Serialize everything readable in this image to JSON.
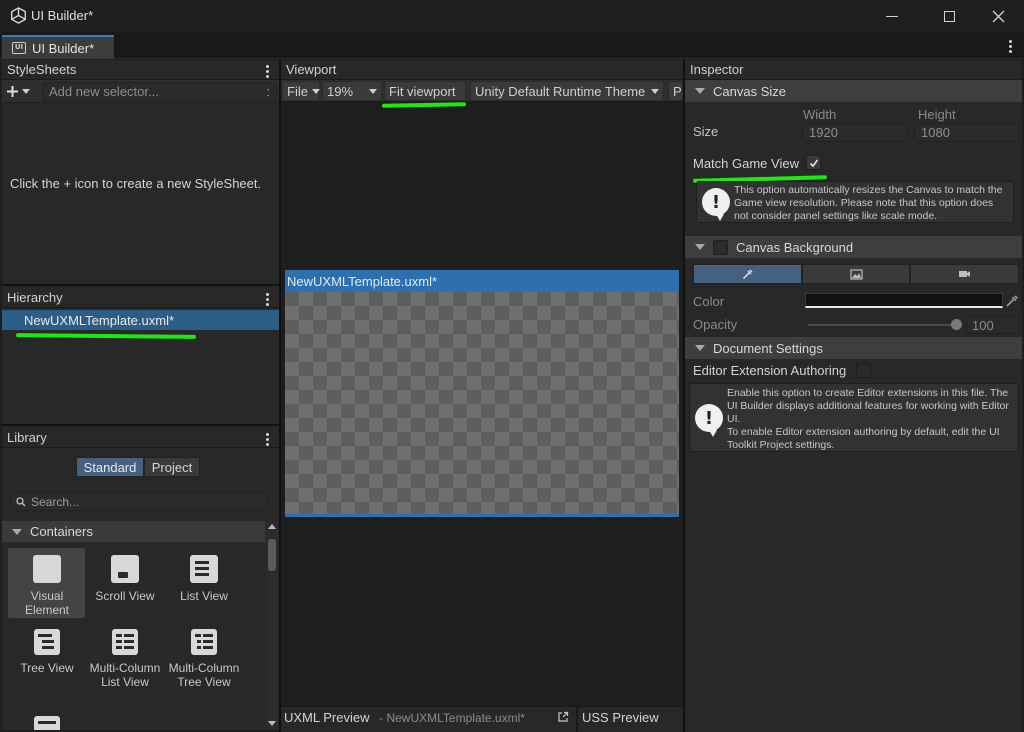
{
  "window": {
    "title": "UI Builder*",
    "tab_label": "UI Builder*",
    "tab_icon_text": "UI"
  },
  "stylesheets": {
    "header": "StyleSheets",
    "selector_placeholder": "Add new selector...",
    "selector_suffix": ":",
    "empty_message": "Click the + icon to create a new StyleSheet."
  },
  "hierarchy": {
    "header": "Hierarchy",
    "items": [
      {
        "label": "NewUXMLTemplate.uxml*"
      }
    ]
  },
  "library": {
    "header": "Library",
    "tabs": [
      {
        "label": "Standard"
      },
      {
        "label": "Project"
      }
    ],
    "search_placeholder": "Search...",
    "section": "Containers",
    "items": [
      {
        "label": "Visual Element",
        "icon": "visual-element-icon"
      },
      {
        "label": "Scroll View",
        "icon": "scroll-view-icon"
      },
      {
        "label": "List View",
        "icon": "list-view-icon"
      },
      {
        "label": "Tree View",
        "icon": "tree-view-icon"
      },
      {
        "label": "Multi-Column List View",
        "icon": "multi-column-list-icon"
      },
      {
        "label": "Multi-Column Tree View",
        "icon": "multi-column-tree-icon"
      }
    ]
  },
  "viewport": {
    "header": "Viewport",
    "file_menu": "File",
    "zoom": "19%",
    "fit_button": "Fit viewport",
    "theme": "Unity Default Runtime Theme",
    "truncated_button": "P",
    "canvas_title": "NewUXMLTemplate.uxml*",
    "uxml_preview_label": "UXML Preview",
    "uxml_preview_file": "- NewUXMLTemplate.uxml*",
    "uss_preview_label": "USS Preview"
  },
  "inspector": {
    "header": "Inspector",
    "canvas_size": {
      "title": "Canvas Size",
      "size_label": "Size",
      "width_label": "Width",
      "height_label": "Height",
      "width": "1920",
      "height": "1080",
      "match_game_view_label": "Match Game View",
      "match_game_view_checked": true,
      "help": "This option automatically resizes the Canvas to match the Game view resolution. Please note that this option does not consider panel settings like scale mode."
    },
    "canvas_background": {
      "title": "Canvas Background",
      "color_label": "Color",
      "opacity_label": "Opacity",
      "opacity": "100",
      "color_value": "#121212"
    },
    "document_settings": {
      "title": "Document Settings",
      "editor_extension_label": "Editor Extension Authoring",
      "help_line1": "Enable this option to create Editor extensions in this file. The UI Builder displays additional features for working with Editor UI.",
      "help_line2": "To enable Editor extension authoring by default, edit the UI Toolkit Project settings."
    }
  },
  "colors": {
    "accent": "#3a79bb",
    "selection": "#2c5d87",
    "annotation": "#1bea0c"
  }
}
